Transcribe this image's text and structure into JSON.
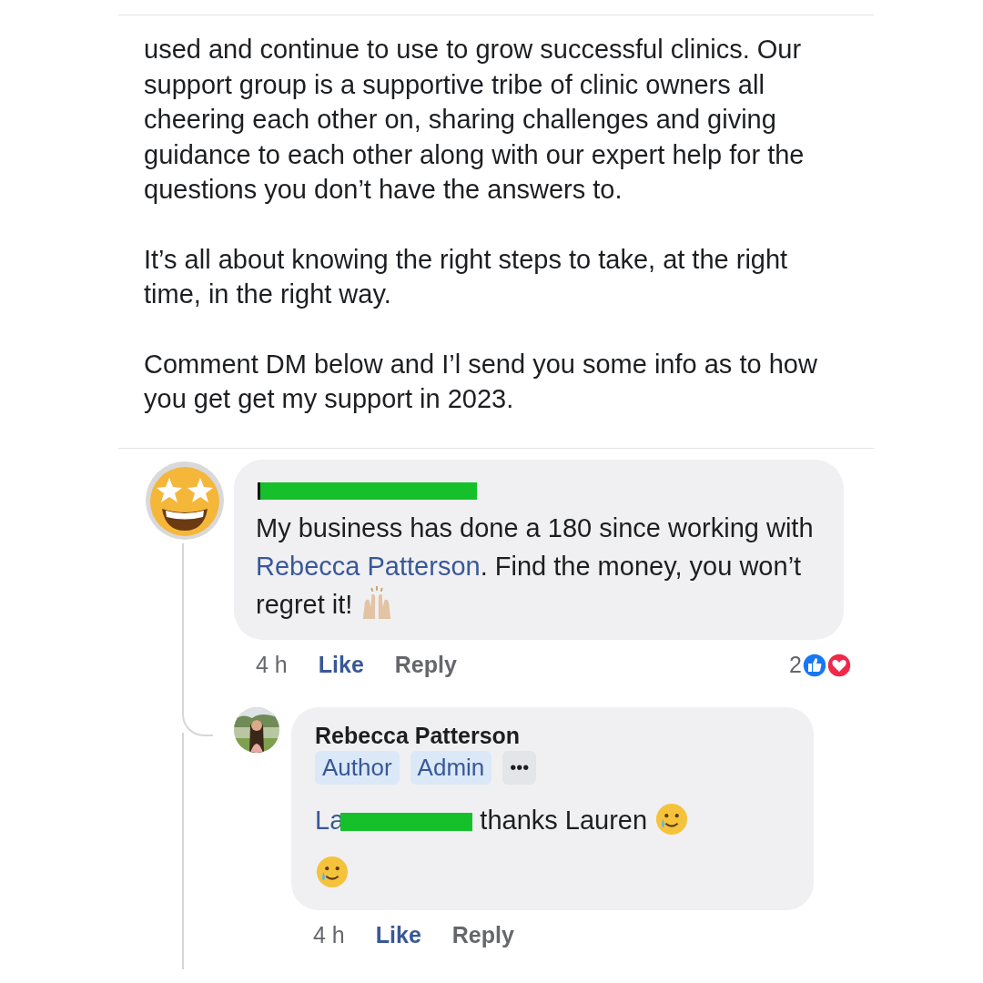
{
  "post": {
    "paragraphs": [
      "used and continue to use to grow successful clinics. Our support group is a supportive tribe of clinic owners all cheering each other on, sharing challenges and giving guidance to each other along with our expert help for the questions you don’t have the answers to.",
      "It’s all about knowing the right steps to take, at the right time, in the right way.",
      "Comment DM below and I’l send you some info as to how you get get my support in 2023."
    ]
  },
  "comments": [
    {
      "avatar": {
        "kind": "emoji"
      },
      "author_redacted": true,
      "lines": [
        [
          {
            "kind": "text",
            "text": "My business has done a 180 since working with "
          },
          {
            "kind": "mention",
            "text": "Rebecca Patterson"
          },
          {
            "kind": "text",
            "text": ". Find the money, you won’t regret it! "
          },
          {
            "kind": "raised_hands"
          }
        ]
      ],
      "time": "4 h",
      "like": "Like",
      "reply": "Reply",
      "reaction_count": "2",
      "reactions": [
        {
          "kind": "like"
        },
        {
          "kind": "love"
        }
      ],
      "replies": [
        {
          "avatar": {
            "kind": "picture"
          },
          "author": "Rebecca Patterson",
          "badges": [
            "Author",
            "Admin"
          ],
          "more": "•••",
          "lines": [
            [
              {
                "kind": "mention",
                "text": "La"
              },
              {
                "kind": "redaction"
              },
              {
                "kind": "text",
                "text": " thanks Lauren "
              },
              {
                "kind": "tear_smile"
              }
            ],
            [
              {
                "kind": "tear_smile"
              }
            ]
          ],
          "time": "4 h",
          "like": "Like",
          "reply": "Reply"
        }
      ]
    }
  ]
}
